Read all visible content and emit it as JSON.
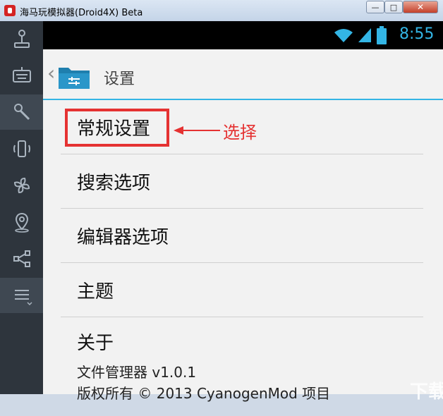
{
  "window": {
    "title": "海马玩模拟器(Droid4X) Beta",
    "min_label": "—",
    "max_label": "□",
    "close_label": "✕"
  },
  "sidebar": {
    "items": [
      {
        "name": "joystick-icon"
      },
      {
        "name": "keyboard-icon"
      },
      {
        "name": "wrench-icon"
      },
      {
        "name": "shake-phone-icon"
      },
      {
        "name": "pinwheel-icon"
      },
      {
        "name": "location-pin-icon"
      },
      {
        "name": "share-icon"
      },
      {
        "name": "menu-icon"
      }
    ]
  },
  "statusbar": {
    "time": "8:55",
    "accent": "#33b5e5"
  },
  "actionbar": {
    "title": "设置",
    "back": "‹"
  },
  "settings": {
    "items": [
      {
        "label": "常规设置"
      },
      {
        "label": "搜索选项"
      },
      {
        "label": "编辑器选项"
      },
      {
        "label": "主题"
      },
      {
        "label": "关于",
        "sub1": "文件管理器 v1.0.1",
        "sub2": "版权所有 © 2013 CyanogenMod 项目"
      }
    ]
  },
  "annotation": {
    "text": "选择",
    "color": "#e53232"
  },
  "watermark": {
    "text": "下载吧"
  }
}
